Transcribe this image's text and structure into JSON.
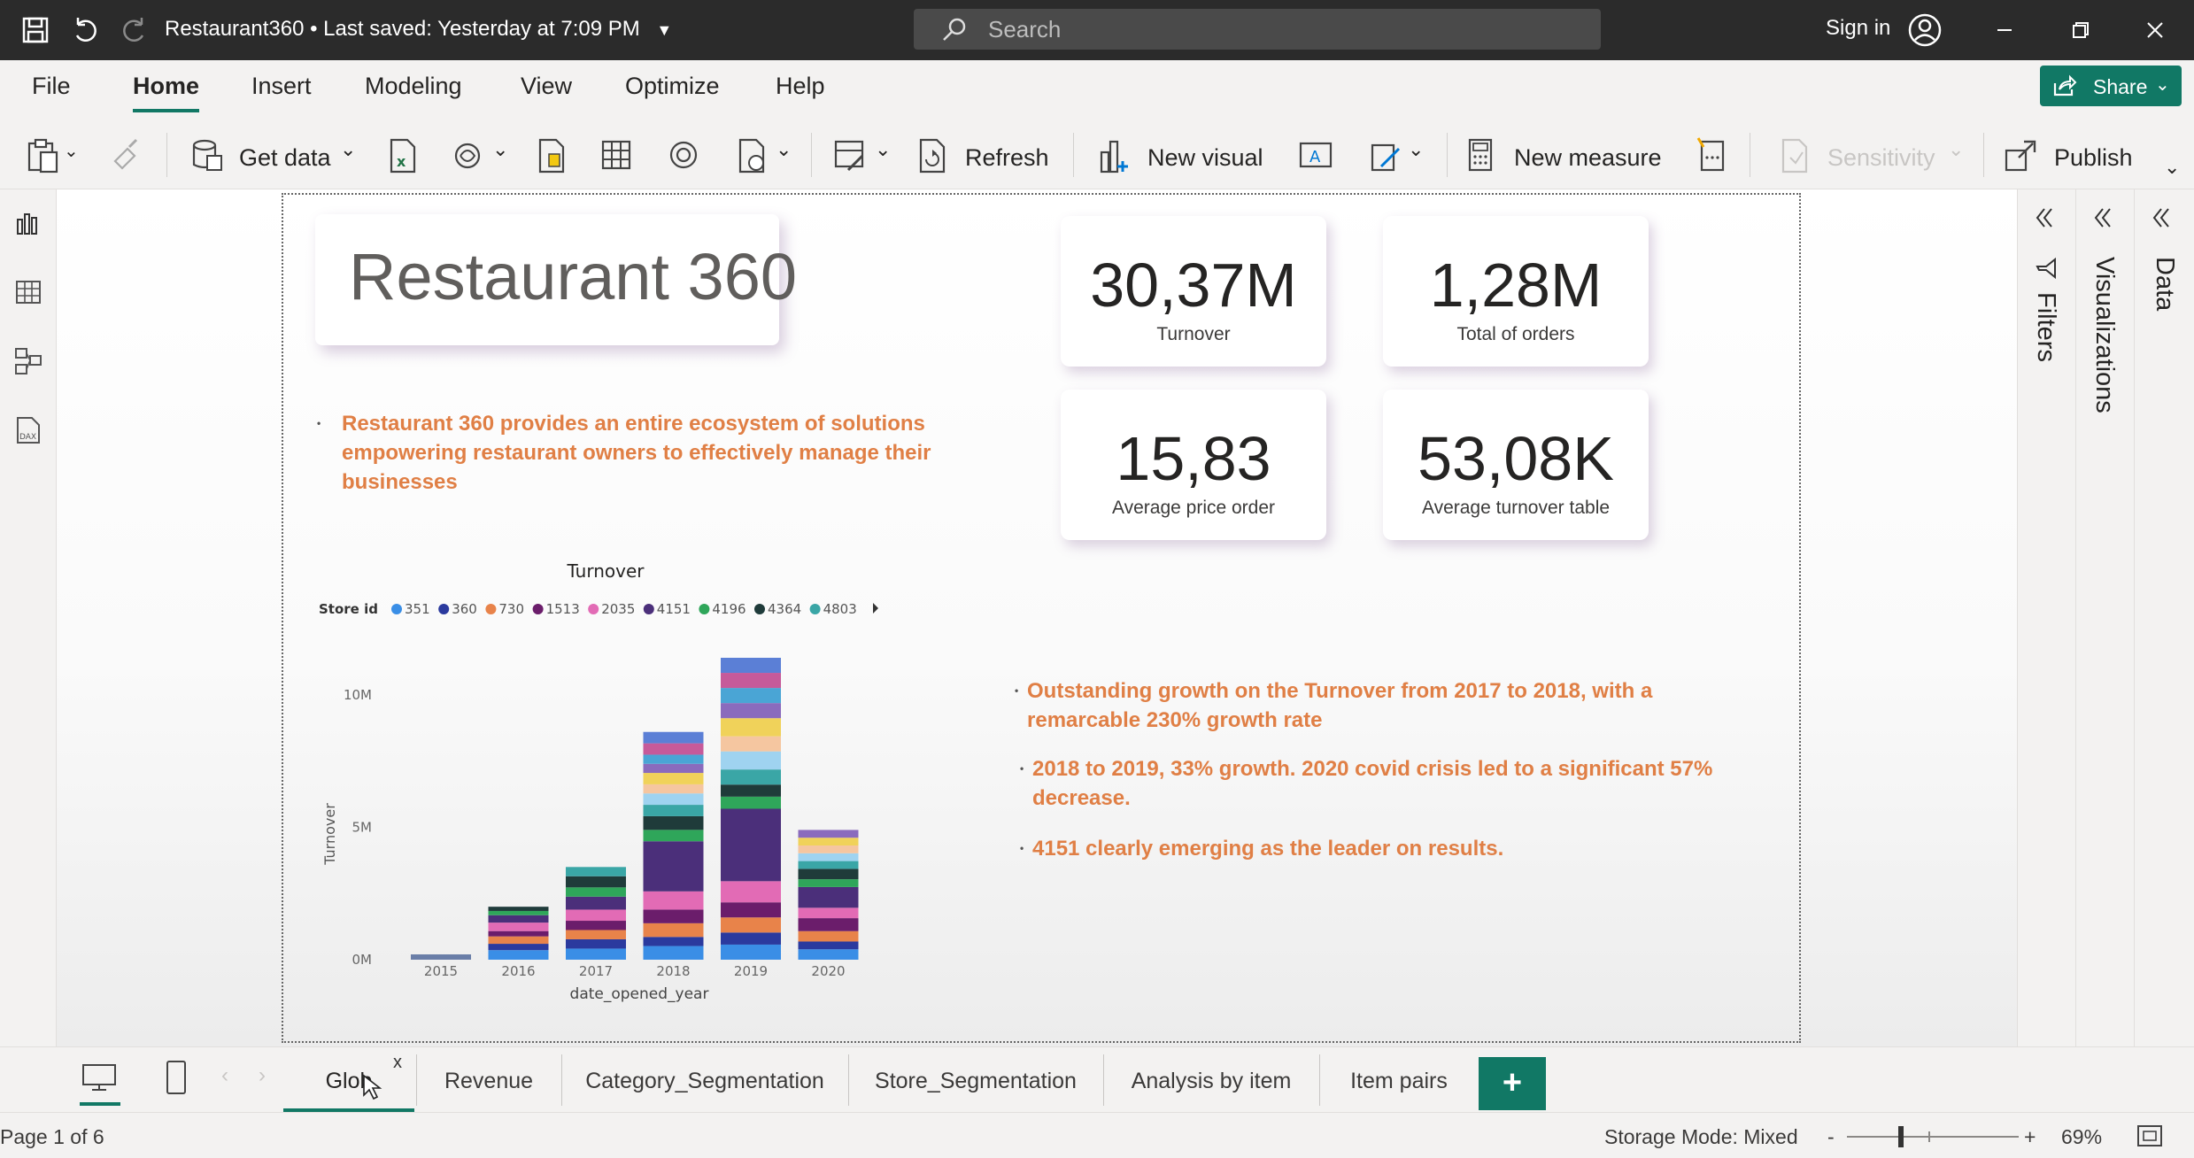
{
  "titlebar": {
    "document_title": "Restaurant360 • Last saved: Yesterday at 7:09 PM",
    "search_placeholder": "Search",
    "sign_in": "Sign in"
  },
  "menu": {
    "tabs": [
      "File",
      "Home",
      "Insert",
      "Modeling",
      "View",
      "Optimize",
      "Help"
    ],
    "active": "Home",
    "share": "Share"
  },
  "ribbon": {
    "get_data": "Get data",
    "refresh": "Refresh",
    "new_visual": "New visual",
    "new_measure": "New measure",
    "sensitivity": "Sensitivity",
    "publish": "Publish"
  },
  "report": {
    "title": "Restaurant 360",
    "intro": "Restaurant 360 provides an entire ecosystem of solutions empowering restaurant owners to effectively manage their businesses",
    "kpis": [
      {
        "value": "30,37M",
        "label": "Turnover"
      },
      {
        "value": "1,28M",
        "label": "Total of orders"
      },
      {
        "value": "15,83",
        "label": "Average price order"
      },
      {
        "value": "53,08K",
        "label": "Average turnover table"
      }
    ],
    "insights": [
      "Outstanding growth on the Turnover from 2017 to 2018, with a remarcable 230% growth rate",
      "2018 to 2019, 33% growth. 2020 covid crisis led to a significant 57% decrease.",
      "4151 clearly emerging as the leader on results."
    ]
  },
  "chart_data": {
    "type": "bar",
    "stacked": true,
    "title": "Turnover",
    "legend_title": "Store id",
    "legend_entries": [
      "351",
      "360",
      "730",
      "1513",
      "2035",
      "4151",
      "4196",
      "4364",
      "4803"
    ],
    "legend_colors": [
      "#3a8ee6",
      "#2b3a9e",
      "#e8834a",
      "#6b1d6b",
      "#e26bb5",
      "#4b2f7a",
      "#2fa65a",
      "#1f3b3a",
      "#3aa6a6"
    ],
    "categories": [
      "2015",
      "2016",
      "2017",
      "2018",
      "2019",
      "2020"
    ],
    "totals": [
      0.2,
      2.0,
      3.5,
      8.6,
      11.4,
      4.9
    ],
    "xlabel": "date_opened_year",
    "ylabel": "Turnover",
    "yticks": [
      "0M",
      "5M",
      "10M"
    ],
    "ylim": [
      0,
      11.5
    ]
  },
  "right_panes": {
    "filters": "Filters",
    "visualizations": "Visualizations",
    "data": "Data"
  },
  "pages": {
    "tabs": [
      "Global",
      "Revenue",
      "Category_Segmentation",
      "Store_Segmentation",
      "Analysis by item",
      "Item pairs"
    ],
    "active_display": "Glob",
    "close_mark": "x",
    "add": "+"
  },
  "status": {
    "page": "Page 1 of 6",
    "storage_mode": "Storage Mode: Mixed",
    "zoom": "69%",
    "zoom_minus": "-",
    "zoom_plus": "+"
  }
}
